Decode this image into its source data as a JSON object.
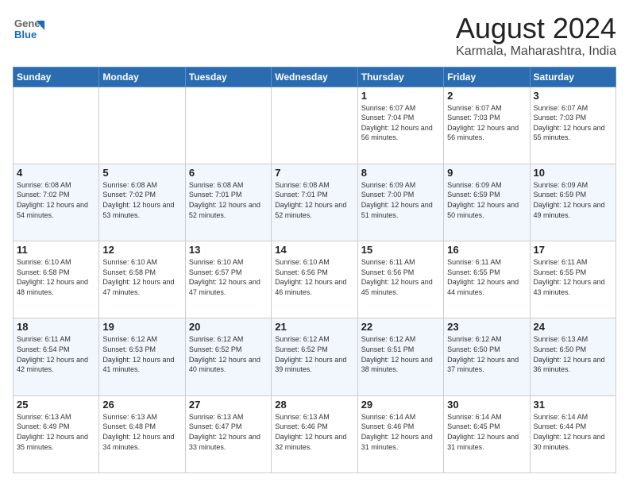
{
  "header": {
    "logo_general": "General",
    "logo_blue": "Blue",
    "title": "August 2024",
    "subtitle": "Karmala, Maharashtra, India"
  },
  "weekdays": [
    "Sunday",
    "Monday",
    "Tuesday",
    "Wednesday",
    "Thursday",
    "Friday",
    "Saturday"
  ],
  "weeks": [
    [
      {
        "day": "",
        "info": ""
      },
      {
        "day": "",
        "info": ""
      },
      {
        "day": "",
        "info": ""
      },
      {
        "day": "",
        "info": ""
      },
      {
        "day": "1",
        "info": "Sunrise: 6:07 AM\nSunset: 7:04 PM\nDaylight: 12 hours\nand 56 minutes."
      },
      {
        "day": "2",
        "info": "Sunrise: 6:07 AM\nSunset: 7:03 PM\nDaylight: 12 hours\nand 56 minutes."
      },
      {
        "day": "3",
        "info": "Sunrise: 6:07 AM\nSunset: 7:03 PM\nDaylight: 12 hours\nand 55 minutes."
      }
    ],
    [
      {
        "day": "4",
        "info": "Sunrise: 6:08 AM\nSunset: 7:02 PM\nDaylight: 12 hours\nand 54 minutes."
      },
      {
        "day": "5",
        "info": "Sunrise: 6:08 AM\nSunset: 7:02 PM\nDaylight: 12 hours\nand 53 minutes."
      },
      {
        "day": "6",
        "info": "Sunrise: 6:08 AM\nSunset: 7:01 PM\nDaylight: 12 hours\nand 52 minutes."
      },
      {
        "day": "7",
        "info": "Sunrise: 6:08 AM\nSunset: 7:01 PM\nDaylight: 12 hours\nand 52 minutes."
      },
      {
        "day": "8",
        "info": "Sunrise: 6:09 AM\nSunset: 7:00 PM\nDaylight: 12 hours\nand 51 minutes."
      },
      {
        "day": "9",
        "info": "Sunrise: 6:09 AM\nSunset: 6:59 PM\nDaylight: 12 hours\nand 50 minutes."
      },
      {
        "day": "10",
        "info": "Sunrise: 6:09 AM\nSunset: 6:59 PM\nDaylight: 12 hours\nand 49 minutes."
      }
    ],
    [
      {
        "day": "11",
        "info": "Sunrise: 6:10 AM\nSunset: 6:58 PM\nDaylight: 12 hours\nand 48 minutes."
      },
      {
        "day": "12",
        "info": "Sunrise: 6:10 AM\nSunset: 6:58 PM\nDaylight: 12 hours\nand 47 minutes."
      },
      {
        "day": "13",
        "info": "Sunrise: 6:10 AM\nSunset: 6:57 PM\nDaylight: 12 hours\nand 47 minutes."
      },
      {
        "day": "14",
        "info": "Sunrise: 6:10 AM\nSunset: 6:56 PM\nDaylight: 12 hours\nand 46 minutes."
      },
      {
        "day": "15",
        "info": "Sunrise: 6:11 AM\nSunset: 6:56 PM\nDaylight: 12 hours\nand 45 minutes."
      },
      {
        "day": "16",
        "info": "Sunrise: 6:11 AM\nSunset: 6:55 PM\nDaylight: 12 hours\nand 44 minutes."
      },
      {
        "day": "17",
        "info": "Sunrise: 6:11 AM\nSunset: 6:55 PM\nDaylight: 12 hours\nand 43 minutes."
      }
    ],
    [
      {
        "day": "18",
        "info": "Sunrise: 6:11 AM\nSunset: 6:54 PM\nDaylight: 12 hours\nand 42 minutes."
      },
      {
        "day": "19",
        "info": "Sunrise: 6:12 AM\nSunset: 6:53 PM\nDaylight: 12 hours\nand 41 minutes."
      },
      {
        "day": "20",
        "info": "Sunrise: 6:12 AM\nSunset: 6:52 PM\nDaylight: 12 hours\nand 40 minutes."
      },
      {
        "day": "21",
        "info": "Sunrise: 6:12 AM\nSunset: 6:52 PM\nDaylight: 12 hours\nand 39 minutes."
      },
      {
        "day": "22",
        "info": "Sunrise: 6:12 AM\nSunset: 6:51 PM\nDaylight: 12 hours\nand 38 minutes."
      },
      {
        "day": "23",
        "info": "Sunrise: 6:12 AM\nSunset: 6:50 PM\nDaylight: 12 hours\nand 37 minutes."
      },
      {
        "day": "24",
        "info": "Sunrise: 6:13 AM\nSunset: 6:50 PM\nDaylight: 12 hours\nand 36 minutes."
      }
    ],
    [
      {
        "day": "25",
        "info": "Sunrise: 6:13 AM\nSunset: 6:49 PM\nDaylight: 12 hours\nand 35 minutes."
      },
      {
        "day": "26",
        "info": "Sunrise: 6:13 AM\nSunset: 6:48 PM\nDaylight: 12 hours\nand 34 minutes."
      },
      {
        "day": "27",
        "info": "Sunrise: 6:13 AM\nSunset: 6:47 PM\nDaylight: 12 hours\nand 33 minutes."
      },
      {
        "day": "28",
        "info": "Sunrise: 6:13 AM\nSunset: 6:46 PM\nDaylight: 12 hours\nand 32 minutes."
      },
      {
        "day": "29",
        "info": "Sunrise: 6:14 AM\nSunset: 6:46 PM\nDaylight: 12 hours\nand 31 minutes."
      },
      {
        "day": "30",
        "info": "Sunrise: 6:14 AM\nSunset: 6:45 PM\nDaylight: 12 hours\nand 31 minutes."
      },
      {
        "day": "31",
        "info": "Sunrise: 6:14 AM\nSunset: 6:44 PM\nDaylight: 12 hours\nand 30 minutes."
      }
    ]
  ]
}
